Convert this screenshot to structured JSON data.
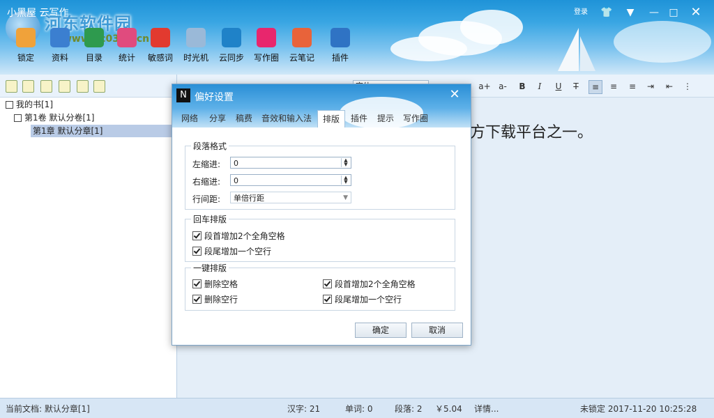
{
  "app": {
    "title": "小黑屋 云写作"
  },
  "watermark": {
    "text": "河东软件园",
    "url": "www.pc0359.cn"
  },
  "toolbar": [
    {
      "label": "锁定",
      "icon": "lock-icon",
      "color": "#f0a23a"
    },
    {
      "label": "资料",
      "icon": "document-icon",
      "color": "#3b7fd0"
    },
    {
      "label": "目录",
      "icon": "list-icon",
      "color": "#2e9a4e"
    },
    {
      "label": "统计",
      "icon": "bar-chart-icon",
      "color": "#e04b7e"
    },
    {
      "label": "敏感词",
      "icon": "chat-bubble-icon",
      "color": "#e23a2f"
    },
    {
      "label": "时光机",
      "icon": "timeline-chart-icon",
      "color": "#9ab9d8"
    },
    {
      "label": "云同步",
      "icon": "cloud-icon",
      "color": "#1f82c8"
    },
    {
      "label": "写作圈",
      "icon": "ring-icon",
      "color": "#e8266d"
    },
    {
      "label": "云笔记",
      "icon": "notebook-icon",
      "color": "#e8633a"
    },
    {
      "label": "插件",
      "icon": "plus-icon",
      "color": "#2f73c4"
    }
  ],
  "window_controls": {
    "login": "登录"
  },
  "tree": {
    "book": "我的书[1]",
    "volume": "第1卷 默认分卷[1]",
    "chapter": "第1章 默认分章[1]"
  },
  "editor": {
    "font_name": "宋体",
    "text": "方下载平台之一。",
    "format_buttons": [
      "a+",
      "a-",
      "B",
      "I",
      "U",
      "T"
    ]
  },
  "dialog": {
    "title": "偏好设置",
    "tabs": [
      "网络",
      "分享",
      "稿费",
      "音效和输入法",
      "排版",
      "插件",
      "提示",
      "写作圈"
    ],
    "active_tab": "排版",
    "paragraph": {
      "title": "段落格式",
      "left_indent_label": "左缩进:",
      "left_indent_value": "0",
      "right_indent_label": "右缩进:",
      "right_indent_value": "0",
      "line_spacing_label": "行间距:",
      "line_spacing_value": "单倍行距"
    },
    "enter_layout": {
      "title": "回车排版",
      "opt1": "段首增加2个全角空格",
      "opt2": "段尾增加一个空行"
    },
    "one_key_layout": {
      "title": "一键排版",
      "opt1": "删除空格",
      "opt2": "删除空行",
      "opt3": "段首增加2个全角空格",
      "opt4": "段尾增加一个空行"
    },
    "ok": "确定",
    "cancel": "取消"
  },
  "status": {
    "current_doc": "当前文档: 默认分章[1]",
    "chars": "汉字: 21",
    "words": "单词: 0",
    "paragraphs": "段落: 2",
    "price": "￥5.04",
    "details": "详情...",
    "lock_time": "未锁定 2017-11-20 10:25:28"
  }
}
